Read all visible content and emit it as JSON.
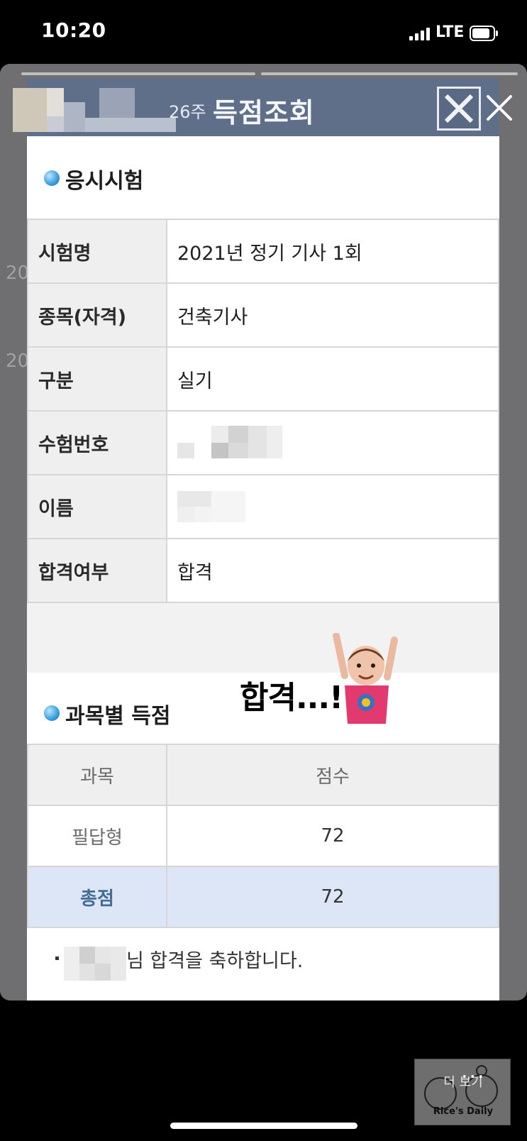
{
  "status_bar": {
    "time": "10:20",
    "network": "LTE",
    "signal_icon": "cellular-signal-icon",
    "battery_icon": "battery-icon"
  },
  "modal": {
    "round": "26주",
    "title": "득점조회",
    "close_icon": "close-icon"
  },
  "exam_section": {
    "title": "응시시험",
    "rows": [
      {
        "label": "시험명",
        "value": "2021년 정기 기사 1회"
      },
      {
        "label": "종목(자격)",
        "value": "건축기사"
      },
      {
        "label": "구분",
        "value": "실기"
      },
      {
        "label": "수험번호",
        "value": ""
      },
      {
        "label": "이름",
        "value": ""
      },
      {
        "label": "합격여부",
        "value": "합격"
      }
    ]
  },
  "sticker_text": "합격...!",
  "score_section": {
    "title": "과목별 득점",
    "header": {
      "subject": "과목",
      "score": "점수"
    },
    "rows": [
      {
        "subject": "필답형",
        "score": "72"
      }
    ],
    "total": {
      "label": "총점",
      "score": "72"
    }
  },
  "footer_note": "님 합격을 축하합니다.",
  "story_ui": {
    "more_icon": "more-dots-icon",
    "more_dots": "...",
    "more_label": "더 보기",
    "brand": "Rice's Daily",
    "bg_numbers": [
      "20",
      "20"
    ]
  },
  "colors": {
    "header": "#5f6f8a",
    "total_row": "#dce6f7",
    "bullet": "#3fa3e0"
  }
}
